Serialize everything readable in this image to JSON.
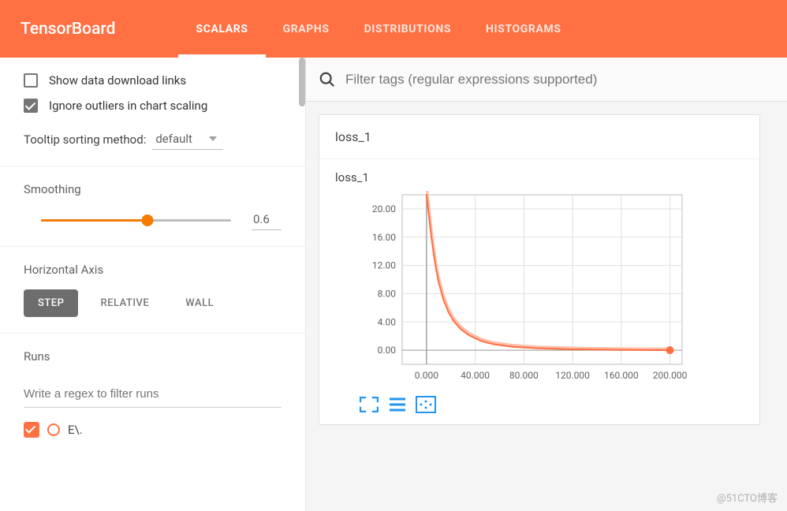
{
  "header": {
    "logo": "TensorBoard",
    "tabs": [
      "SCALARS",
      "GRAPHS",
      "DISTRIBUTIONS",
      "HISTOGRAMS"
    ],
    "active_tab": 0
  },
  "sidebar": {
    "show_download": {
      "label": "Show data download links",
      "checked": false
    },
    "ignore_outliers": {
      "label": "Ignore outliers in chart scaling",
      "checked": true
    },
    "tooltip_sort": {
      "label": "Tooltip sorting method:",
      "value": "default"
    },
    "smoothing": {
      "label": "Smoothing",
      "value": "0.6"
    },
    "horizontal_axis": {
      "label": "Horizontal Axis",
      "options": [
        "STEP",
        "RELATIVE",
        "WALL"
      ],
      "active": 0
    },
    "runs": {
      "label": "Runs",
      "filter_placeholder": "Write a regex to filter runs",
      "items": [
        {
          "name": "E\\.",
          "checked": true
        }
      ]
    }
  },
  "main": {
    "filter_placeholder": "Filter tags (regular expressions supported)",
    "card": {
      "header": "loss_1",
      "chart_title": "loss_1"
    }
  },
  "chart_data": {
    "type": "line",
    "title": "loss_1",
    "xlabel": "",
    "ylabel": "",
    "xlim": [
      -20,
      210
    ],
    "ylim": [
      -2,
      22
    ],
    "x_ticks": [
      0.0,
      40.0,
      80.0,
      120.0,
      160.0,
      200.0
    ],
    "y_ticks": [
      0.0,
      4.0,
      8.0,
      12.0,
      16.0,
      20.0
    ],
    "series": [
      {
        "name": "E\\.",
        "color": "#ff6f42",
        "x": [
          0,
          2,
          4,
          6,
          8,
          10,
          14,
          18,
          22,
          28,
          35,
          45,
          55,
          70,
          90,
          120,
          160,
          200
        ],
        "y": [
          22,
          19,
          16,
          13.5,
          11.3,
          9.6,
          7.1,
          5.4,
          4.2,
          3.0,
          2.1,
          1.3,
          0.85,
          0.5,
          0.28,
          0.12,
          0.04,
          0.0
        ]
      }
    ],
    "highlight_point": {
      "x": 200,
      "y": 0.0
    }
  },
  "watermark": "@51CTO博客"
}
